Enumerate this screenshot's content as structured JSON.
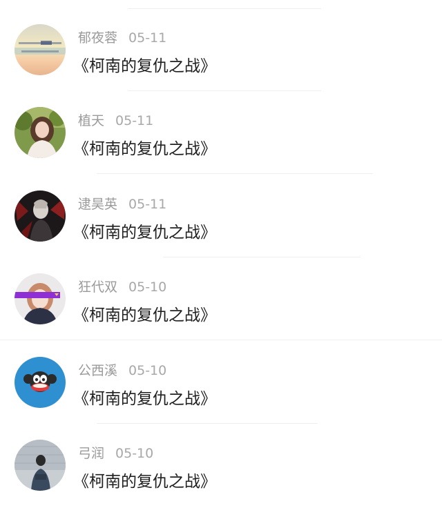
{
  "comments": [
    {
      "name": "郁夜蓉",
      "date": "05-11",
      "title": "《柯南的复仇之战》",
      "avatar": "text-art-avatar"
    },
    {
      "name": "植天",
      "date": "05-11",
      "title": "《柯南的复仇之战》",
      "avatar": "girl-photo-avatar"
    },
    {
      "name": "逮昊英",
      "date": "05-11",
      "title": "《柯南的复仇之战》",
      "avatar": "dark-art-avatar"
    },
    {
      "name": "狂代双",
      "date": "05-10",
      "title": "《柯南的复仇之战》",
      "avatar": "girl-banner-avatar"
    },
    {
      "name": "公西溪",
      "date": "05-10",
      "title": "《柯南的复仇之战》",
      "avatar": "monkey-avatar"
    },
    {
      "name": "弓润",
      "date": "05-10",
      "title": "《柯南的复仇之战》",
      "avatar": "street-photo-avatar"
    }
  ]
}
